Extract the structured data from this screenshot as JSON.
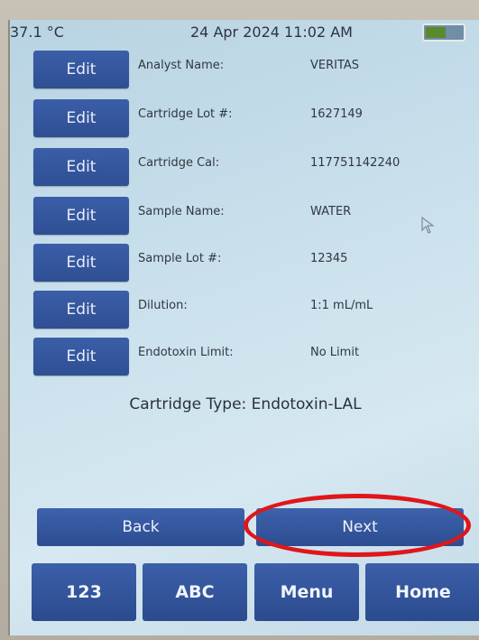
{
  "status": {
    "temperature": "37.1 °C",
    "datetime": "24 Apr 2024 11:02 AM",
    "battery_level": 0.55
  },
  "fields": [
    {
      "edit_label": "Edit",
      "label": "Analyst Name:",
      "value": "VERITAS"
    },
    {
      "edit_label": "Edit",
      "label": "Cartridge Lot #:",
      "value": "1627149"
    },
    {
      "edit_label": "Edit",
      "label": "Cartridge Cal:",
      "value": "117751142240"
    },
    {
      "edit_label": "Edit",
      "label": "Sample Name:",
      "value": "WATER"
    },
    {
      "edit_label": "Edit",
      "label": "Sample Lot #:",
      "value": "12345"
    },
    {
      "edit_label": "Edit",
      "label": "Dilution:",
      "value": "1:1 mL/mL"
    },
    {
      "edit_label": "Edit",
      "label": "Endotoxin Limit:",
      "value": "No Limit"
    }
  ],
  "cartridge_type": "Cartridge Type: Endotoxin-LAL",
  "nav": {
    "back_label": "Back",
    "next_label": "Next"
  },
  "keypad": {
    "numeric_label": "123",
    "alpha_label": "ABC",
    "menu_label": "Menu",
    "home_label": "Home"
  },
  "colors": {
    "button_blue": "#2f4f93",
    "highlight_red": "#e0161b",
    "battery_green": "#5a8a2c"
  },
  "icons": {
    "cursor": "mouse-pointer-icon",
    "battery": "battery-icon"
  }
}
